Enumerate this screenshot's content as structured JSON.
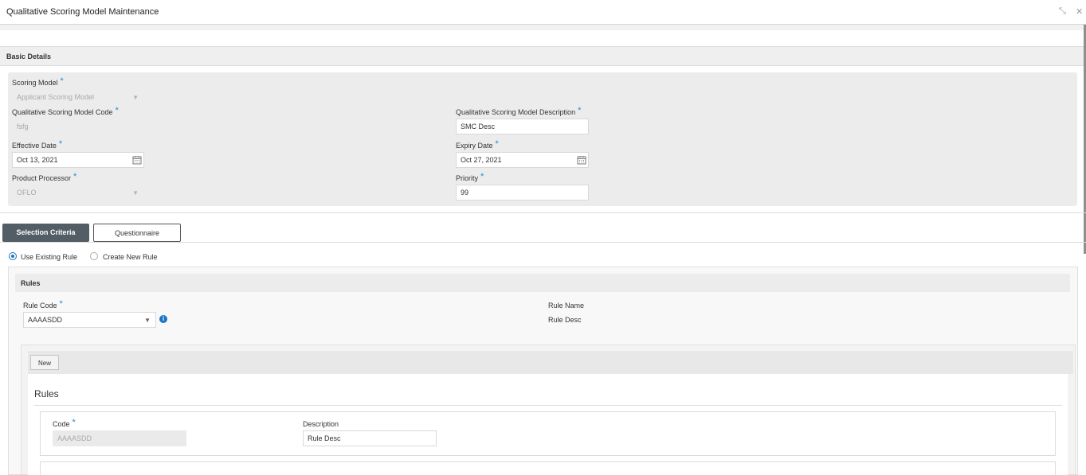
{
  "window": {
    "title": "Qualitative Scoring Model Maintenance",
    "minimize": "⤡",
    "close": "✕"
  },
  "basic_details": {
    "heading": "Basic Details",
    "required": "*",
    "scoring_model": {
      "label": "Scoring Model",
      "value": "Applicant Scoring Model"
    },
    "code": {
      "label": "Qualitative Scoring Model Code",
      "value": "fsfg"
    },
    "description": {
      "label": "Qualitative Scoring Model Description",
      "value": "SMC Desc"
    },
    "effective_date": {
      "label": "Effective Date",
      "value": "Oct 13, 2021"
    },
    "expiry_date": {
      "label": "Expiry Date",
      "value": "Oct 27, 2021"
    },
    "product_processor": {
      "label": "Product Processor",
      "value": "OFLO"
    },
    "priority": {
      "label": "Priority",
      "value": "99"
    }
  },
  "tabs": [
    {
      "label": "Selection Criteria",
      "active": true
    },
    {
      "label": "Questionnaire",
      "active": false
    }
  ],
  "rule_option": {
    "options": [
      "Use Existing Rule",
      "Create New Rule"
    ],
    "selected": "Use Existing Rule"
  },
  "rules": {
    "heading": "Rules",
    "rule_code": {
      "label": "Rule Code",
      "value": "AAAASDD"
    },
    "rule_name_label": "Rule Name",
    "rule_desc_label": "Rule Desc",
    "info_icon": "i"
  },
  "rule_editor": {
    "new_button": "New",
    "title": "Rules",
    "code": {
      "label": "Code",
      "value": "AAAASDD"
    },
    "description": {
      "label": "Description",
      "value": "Rule Desc"
    }
  },
  "colors": {
    "accent": "#1a8fd0",
    "tab_active": "#525d66",
    "radio": "#1a74c7"
  }
}
